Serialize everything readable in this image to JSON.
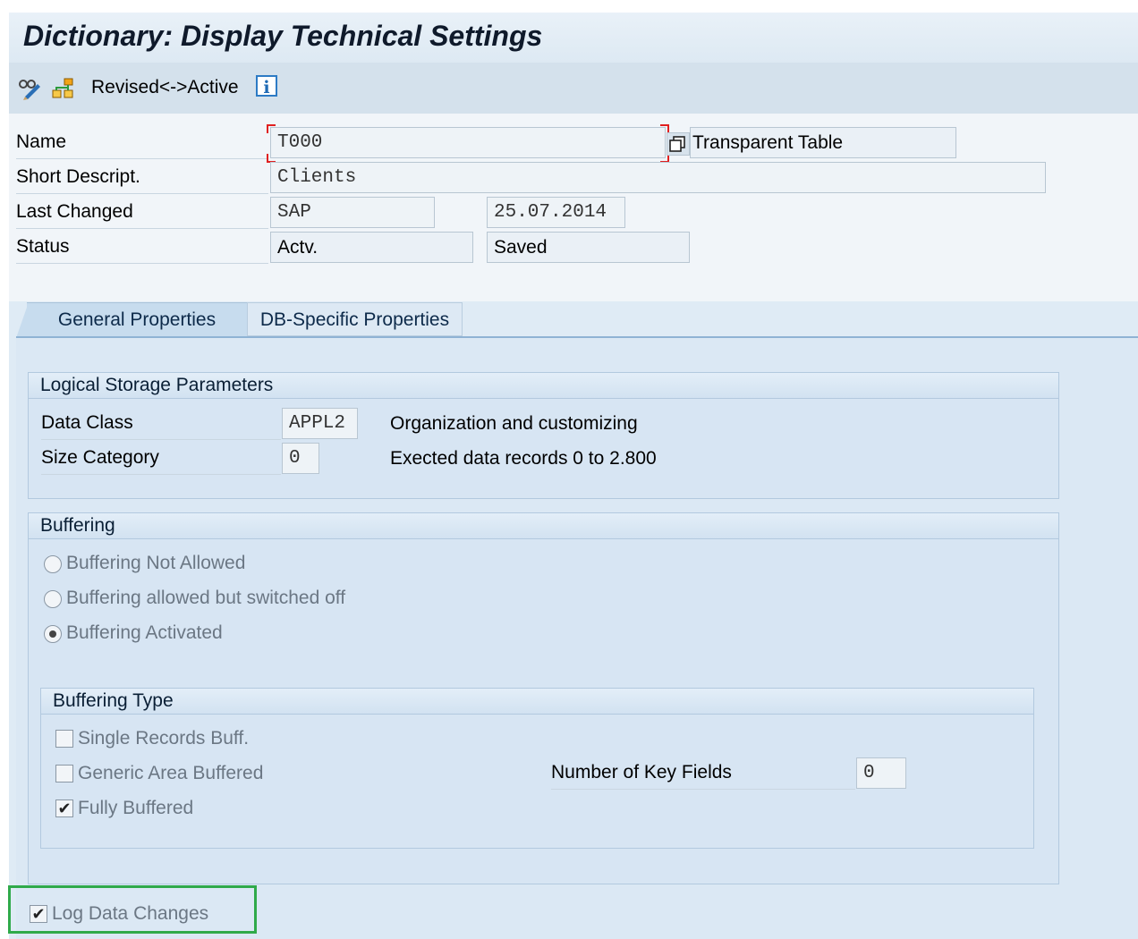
{
  "window": {
    "title": "Dictionary: Display Technical Settings"
  },
  "toolbar": {
    "icons": [
      "glasses-pencil-icon",
      "hierarchy-icon"
    ],
    "revised_label": "Revised<->Active",
    "info_glyph": "i"
  },
  "header": {
    "name_label": "Name",
    "name_value": "T000",
    "table_type": "Transparent Table",
    "short_descript_label": "Short Descript.",
    "short_descript_value": "Clients",
    "last_changed_label": "Last Changed",
    "last_changed_user": "SAP",
    "last_changed_date": "25.07.2014",
    "status_label": "Status",
    "status_value": "Actv.",
    "status_saved": "Saved"
  },
  "tabs": [
    {
      "label": "General Properties",
      "active": true
    },
    {
      "label": "DB-Specific Properties",
      "active": false
    }
  ],
  "logical_storage": {
    "title": "Logical Storage Parameters",
    "data_class_label": "Data Class",
    "data_class_value": "APPL2",
    "data_class_desc": "Organization and customizing",
    "size_category_label": "Size Category",
    "size_category_value": "0",
    "size_category_desc": "Exected data records 0 to 2.800"
  },
  "buffering": {
    "title": "Buffering",
    "options": [
      {
        "label": "Buffering Not Allowed",
        "selected": false
      },
      {
        "label": "Buffering allowed but switched off",
        "selected": false
      },
      {
        "label": "Buffering Activated",
        "selected": true
      }
    ]
  },
  "buffering_type": {
    "title": "Buffering Type",
    "single_records": {
      "label": "Single Records Buff.",
      "checked": false
    },
    "generic_area": {
      "label": "Generic Area Buffered",
      "checked": false
    },
    "fully_buffered": {
      "label": "Fully Buffered",
      "checked": true
    },
    "key_fields_label": "Number of Key Fields",
    "key_fields_value": "0"
  },
  "log_data_changes": {
    "label": "Log Data Changes",
    "checked": true
  },
  "check_glyph": "✔",
  "colors": {
    "highlight_box": "#2faa4a",
    "focus_marks": "#e02020",
    "info_icon": "#2d7bc5"
  }
}
